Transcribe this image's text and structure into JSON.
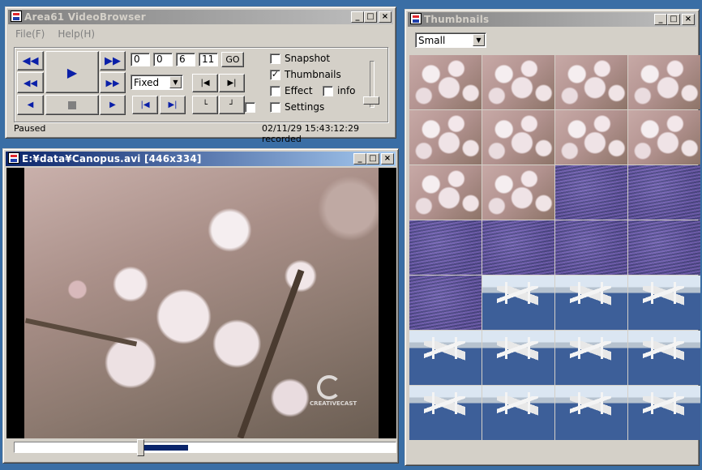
{
  "main_window": {
    "title": "Area61 VideoBrowser",
    "menu": [
      "File(F)",
      "Help(H)"
    ],
    "time_fields": [
      "0",
      "0",
      "6",
      "11"
    ],
    "go_label": "GO",
    "mode_select": "Fixed",
    "checkboxes": {
      "snapshot": {
        "label": "Snapshot",
        "checked": false
      },
      "thumbnails": {
        "label": "Thumbnails",
        "checked": true
      },
      "effect": {
        "label": "Effect",
        "checked": false
      },
      "info": {
        "label": "info",
        "checked": false
      },
      "settings": {
        "label": "Settings",
        "checked": false
      }
    },
    "status_left": "Paused",
    "status_right": "02/11/29 15:43:12:29 recorded"
  },
  "video_window": {
    "title": "E:¥data¥Canopus.avi [446x334]",
    "watermark": "CREATIVECAST",
    "seek_progress": 0.33
  },
  "thumbs_window": {
    "title": "Thumbnails",
    "size_select": "Small",
    "rows": [
      [
        "blossom",
        "blossom",
        "blossom",
        "blossom"
      ],
      [
        "blossom",
        "blossom",
        "blossom",
        "blossom"
      ],
      [
        "blossom",
        "blossom",
        "flowers",
        "flowers"
      ],
      [
        "flowers",
        "flowers",
        "flowers",
        "flowers"
      ],
      [
        "flowers",
        "bridge",
        "bridge",
        "bridge"
      ],
      [
        "bridge",
        "bridge",
        "bridge",
        "bridge"
      ],
      [
        "bridge",
        "bridge",
        "bridge",
        "bridge"
      ]
    ]
  },
  "colors": {
    "desktop": "#3a6ea5",
    "titlebar_active": "#0a246a",
    "face": "#d4d0c8"
  }
}
